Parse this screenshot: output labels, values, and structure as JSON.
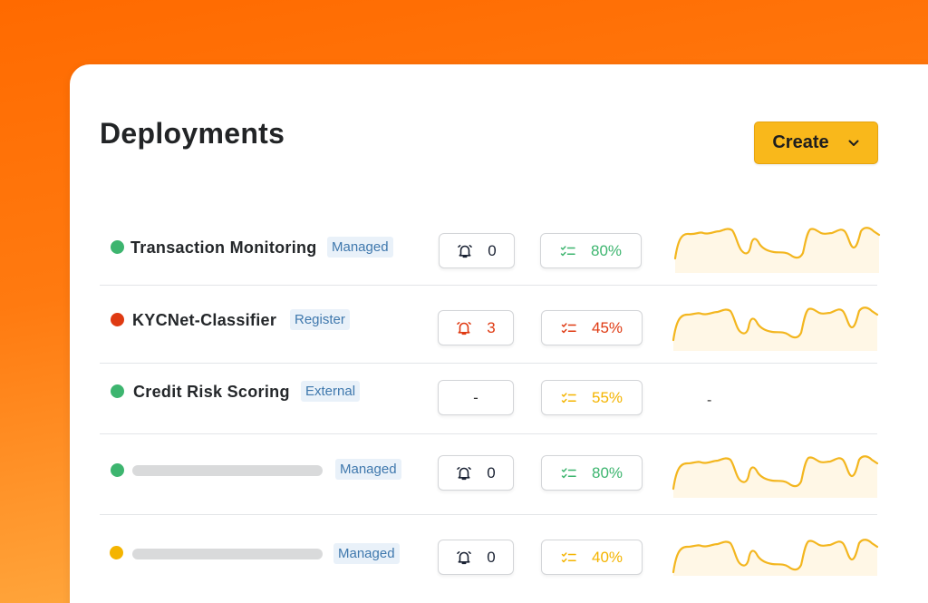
{
  "header": {
    "title": "Deployments",
    "create_label": "Create"
  },
  "colors": {
    "green": "#3db56f",
    "red": "#df3a12",
    "yellow": "#f4b400",
    "alert_dark": "#1a2233",
    "spark": "#f3b61f"
  },
  "rows": [
    {
      "name": "Transaction Monitoring",
      "tag": "Managed",
      "status": "green",
      "alerts": "0",
      "alert_color": "dark",
      "score": "80%",
      "score_color": "green",
      "sparkline": true
    },
    {
      "name": "KYCNet-Classifier",
      "tag": "Register",
      "status": "red",
      "alerts": "3",
      "alert_color": "red",
      "score": "45%",
      "score_color": "red",
      "sparkline": true
    },
    {
      "name": "Credit Risk Scoring",
      "tag": "External",
      "status": "green",
      "alerts": "-",
      "alert_color": "none",
      "score": "55%",
      "score_color": "yellow",
      "sparkline": false,
      "sparkline_placeholder": "-"
    },
    {
      "name": "",
      "tag": "Managed",
      "status": "green",
      "alerts": "0",
      "alert_color": "dark",
      "score": "80%",
      "score_color": "green",
      "sparkline": true
    },
    {
      "name": "",
      "tag": "Managed",
      "status": "yellow",
      "alerts": "0",
      "alert_color": "dark",
      "score": "40%",
      "score_color": "yellow",
      "sparkline": true
    }
  ],
  "icons": {
    "alert": "bell-icon",
    "score": "checklist-icon",
    "create": "chevron-down-icon"
  }
}
